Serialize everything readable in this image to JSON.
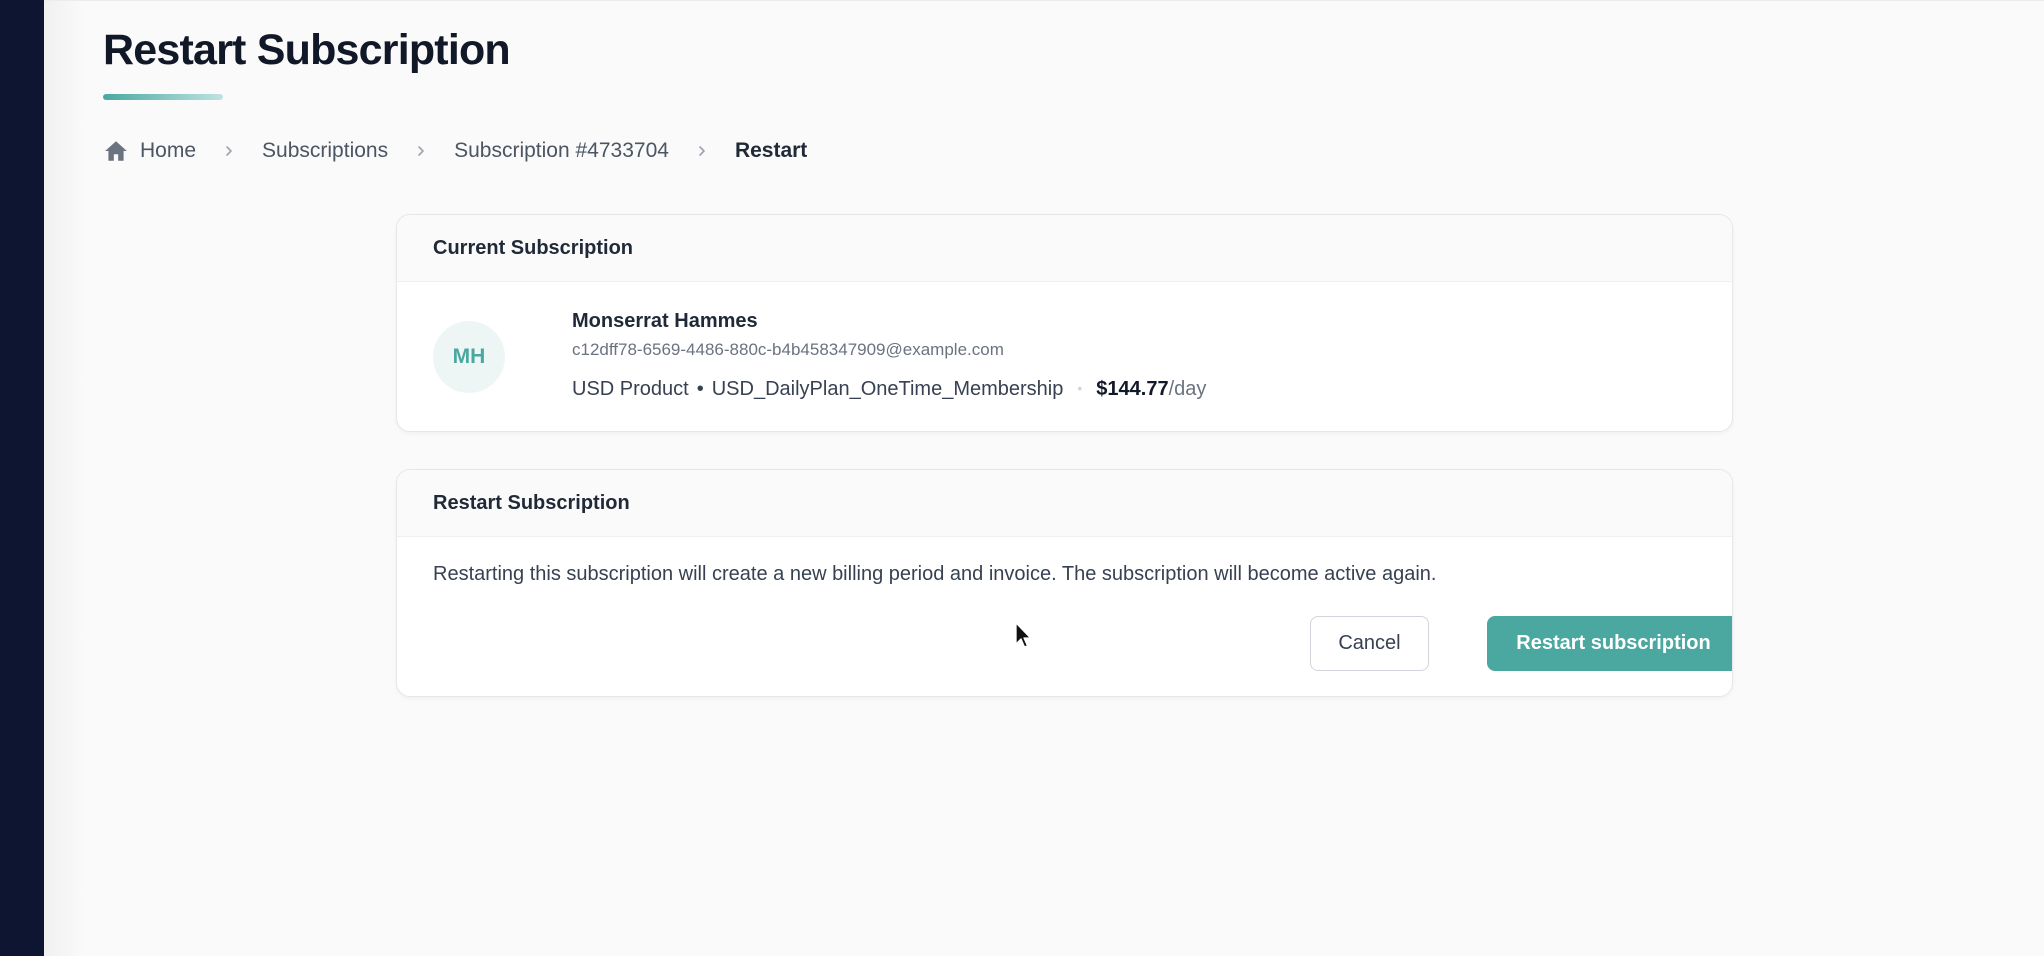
{
  "page": {
    "title": "Restart Subscription"
  },
  "breadcrumb": {
    "home": "Home",
    "subscriptions": "Subscriptions",
    "subscription": "Subscription #4733704",
    "current": "Restart"
  },
  "current_subscription": {
    "header": "Current Subscription",
    "avatar_initials": "MH",
    "customer_name": "Monserrat Hammes",
    "customer_email": "c12dff78-6569-4486-880c-b4b458347909@example.com",
    "product": "USD Product",
    "plan": "USD_DailyPlan_OneTime_Membership",
    "price": "$144.77",
    "period": "/day"
  },
  "restart": {
    "header": "Restart Subscription",
    "description": "Restarting this subscription will create a new billing period and invoice. The subscription will become active again.",
    "cancel_label": "Cancel",
    "confirm_label": "Restart subscription"
  },
  "colors": {
    "accent": "#4aa8a1",
    "sidebar": "#0d1530",
    "background": "#fafafa"
  },
  "icons": {
    "home": "home-icon",
    "separator": "chevron-right-icon",
    "cursor": "mouse-pointer-icon"
  }
}
